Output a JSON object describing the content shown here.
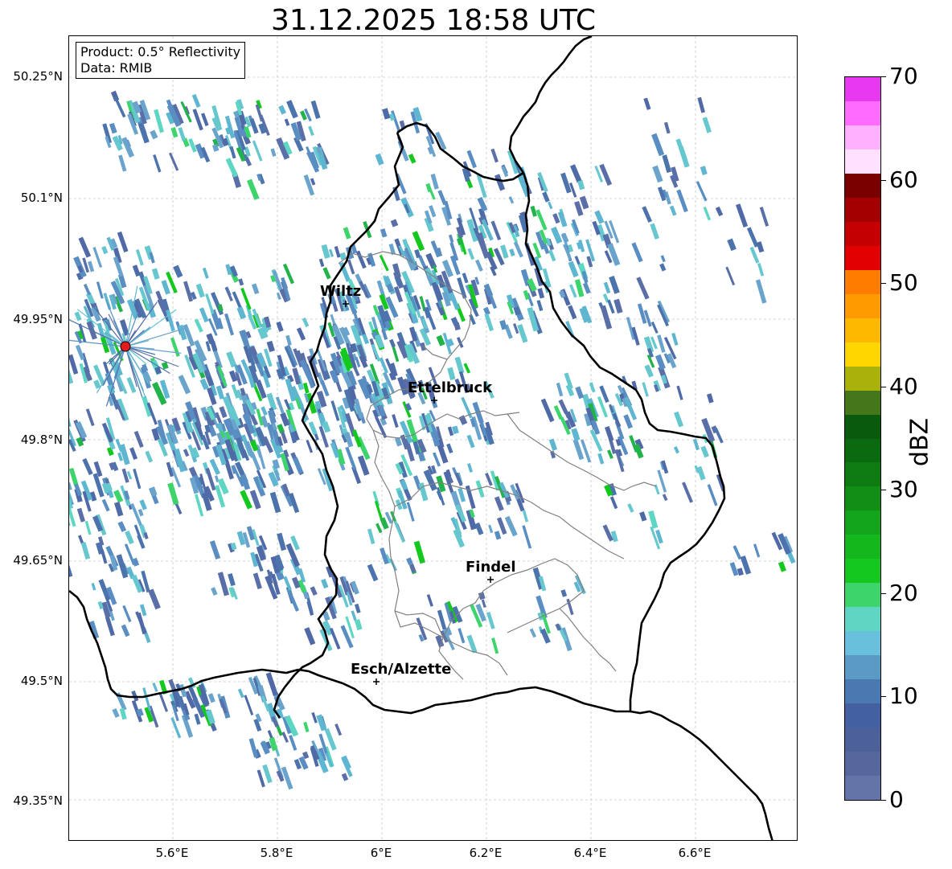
{
  "title": "31.12.2025 18:58 UTC",
  "info_box": {
    "product": "Product: 0.5° Reflectivity",
    "data": "Data: RMIB"
  },
  "latitude_labels": [
    "50.25°N",
    "50.1°N",
    "49.95°N",
    "49.8°N",
    "49.65°N",
    "49.5°N",
    "49.35°N"
  ],
  "longitude_labels": [
    "5.6°E",
    "5.8°E",
    "6°E",
    "6.2°E",
    "6.4°E",
    "6.6°E"
  ],
  "cities": [
    {
      "name": "Wiltz"
    },
    {
      "name": "Ettelbruck"
    },
    {
      "name": "Findel"
    },
    {
      "name": "Esch/Alzette"
    }
  ],
  "radar_site_color": "#e41a1c",
  "colorbar": {
    "label": "dBZ",
    "ticks": [
      "0",
      "10",
      "20",
      "30",
      "40",
      "50",
      "60",
      "70"
    ],
    "colors": [
      "#6374a8",
      "#56679e",
      "#4c619a",
      "#4360a0",
      "#4a78b0",
      "#5a9ac4",
      "#68c0dc",
      "#5fd6c4",
      "#3dd46c",
      "#14c81f",
      "#14b81c",
      "#12a41a",
      "#108e16",
      "#0d7a12",
      "#0b6a10",
      "#095a0d",
      "#44761a",
      "#aab20a",
      "#ffd600",
      "#ffb800",
      "#ff9a00",
      "#ff7c00",
      "#e20000",
      "#c40000",
      "#a40000",
      "#7a0000",
      "#ffe0ff",
      "#ffb0ff",
      "#ff6cff",
      "#e838f0"
    ]
  }
}
